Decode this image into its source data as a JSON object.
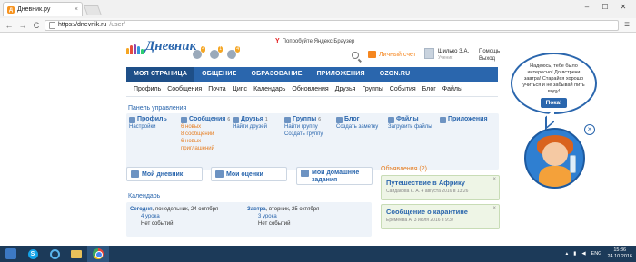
{
  "browser": {
    "tab_title": "Дневник.ру",
    "tab_close": "×",
    "url_host": "https://dnevnik.ru",
    "url_path": "/user/",
    "window_controls": [
      "–",
      "☐",
      "✕"
    ],
    "back": "←",
    "forward": "→",
    "reload": "C",
    "menu": "≡"
  },
  "site": {
    "logo_text": "Дневник",
    "notif_badges": [
      "4",
      "1",
      "4"
    ],
    "yandex_letter": "Y",
    "yandex_text": "Попробуйте Яндекс.Браузер",
    "wallet_label": "Личный счет",
    "user_name": "Шилько З.А.",
    "user_role": "Ученик",
    "help_line1": "Помощь",
    "help_line2": "Выход"
  },
  "main_nav": [
    "МОЯ СТРАНИЦА",
    "ОБЩЕНИЕ",
    "ОБРАЗОВАНИЕ",
    "ПРИЛОЖЕНИЯ",
    "OZON.RU"
  ],
  "main_nav_active": "МОЯ СТРАНИЦА",
  "sub_nav": [
    "Профиль",
    "Сообщения",
    "Почта",
    "Ципс",
    "Календарь",
    "Обновления",
    "Друзья",
    "Группы",
    "События",
    "Блог",
    "Файлы"
  ],
  "control_panel": {
    "title": "Панель управления",
    "profile": {
      "title": "Профиль",
      "link": "Настройки"
    },
    "messages": {
      "title": "Сообщения",
      "badge": "6",
      "line1": "6 новых",
      "line2": "8 сообщений",
      "line3": "6 новых",
      "line4": "приглашений"
    },
    "friends": {
      "title": "Друзья",
      "badge": "1",
      "link": "Найти друзей"
    },
    "groups": {
      "title": "Группы",
      "badge": "6",
      "link1": "Найти группу",
      "link2": "Создать группу"
    },
    "blog": {
      "title": "Блог",
      "link": "Создать заметку"
    },
    "files": {
      "title": "Файлы",
      "link": "Загрузить файлы"
    },
    "apps": {
      "title": "Приложения"
    }
  },
  "widgets": {
    "my_diary": "Мой дневник",
    "my_grades": "Мои оценки",
    "homework_1": "Мои домашние",
    "homework_2": "задания"
  },
  "calendar": {
    "title": "Календарь",
    "today_label": "Сегодня",
    "today_date": ", понедельник, 24 октября",
    "today_lessons": "4 урока",
    "today_events": "Нет событий",
    "tomorrow_label": "Завтра",
    "tomorrow_date": ", вторник, 25 октября",
    "tomorrow_lessons": "3 урока",
    "tomorrow_events": "Нет событий"
  },
  "ads": {
    "title": "Объявления (2)",
    "close": "×",
    "items": [
      {
        "title": "Путешествие в Африку",
        "meta": "Сайдакова К. А. 4 августа 2016 в 13:26"
      },
      {
        "title": "Сообщение о карантине",
        "meta": "Еремеева А. 3 июля 2016 в 9:37"
      }
    ]
  },
  "bubble": {
    "message": "Надеюсь, тебе было интересно! До встречи завтра! Старайся хорошо учиться и не забывай пить воду!",
    "button": "Пока!",
    "close": "×"
  },
  "taskbar": {
    "lang": "ENG",
    "time": "15:36",
    "date": "24.10.2016",
    "skype_letter": "S"
  }
}
